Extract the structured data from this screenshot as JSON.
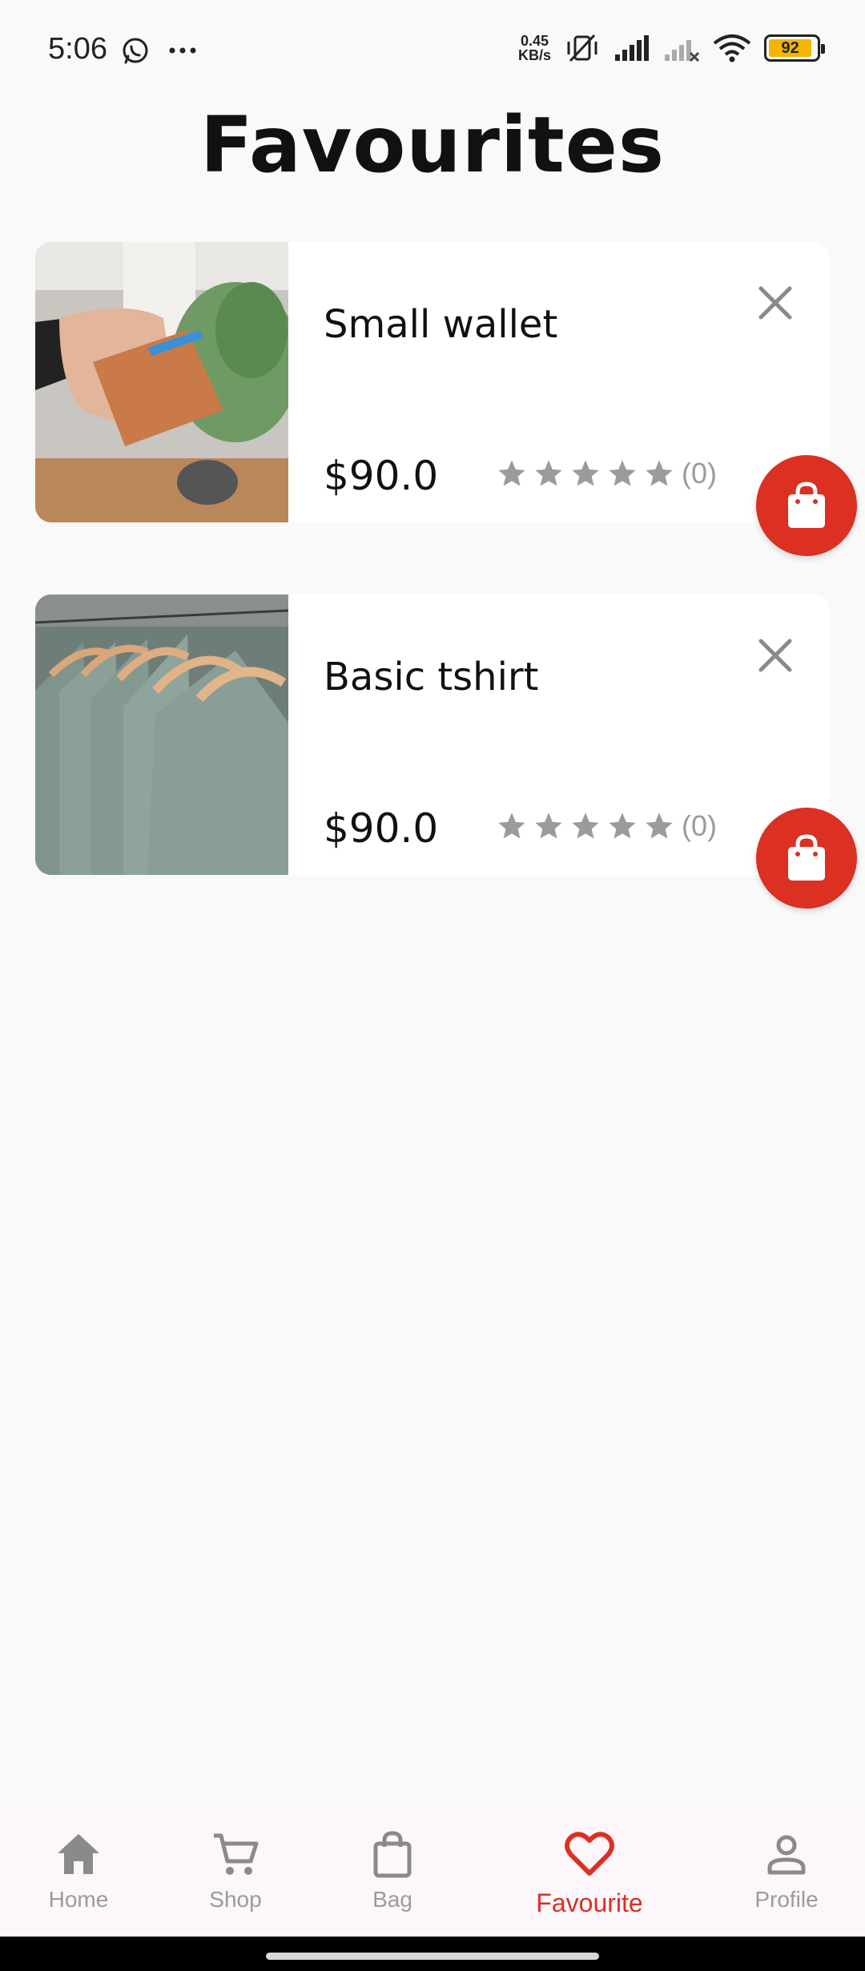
{
  "status_bar": {
    "time": "5:06",
    "net_speed_value": "0.45",
    "net_speed_unit": "KB/s",
    "battery_level": "92",
    "battery_fraction": 0.92
  },
  "page": {
    "title": "Favourites"
  },
  "favourites": [
    {
      "name": "Small wallet",
      "price": "$90.0",
      "rating_stars": 0,
      "rating_count": "(0)",
      "image": "wallet-photo"
    },
    {
      "name": "Basic tshirt",
      "price": "$90.0",
      "rating_stars": 0,
      "rating_count": "(0)",
      "image": "tshirts-photo"
    }
  ],
  "bottom_nav": {
    "items": [
      {
        "label": "Home",
        "icon": "home-icon"
      },
      {
        "label": "Shop",
        "icon": "cart-icon"
      },
      {
        "label": "Bag",
        "icon": "bag-icon"
      },
      {
        "label": "Favourite",
        "icon": "heart-icon",
        "active": true
      },
      {
        "label": "Profile",
        "icon": "person-icon"
      }
    ]
  },
  "colors": {
    "accent": "#db3022",
    "background": "#f9f9f9",
    "card": "#ffffff",
    "muted": "#9b9b9b",
    "nav_background": "#fdf6fa"
  }
}
